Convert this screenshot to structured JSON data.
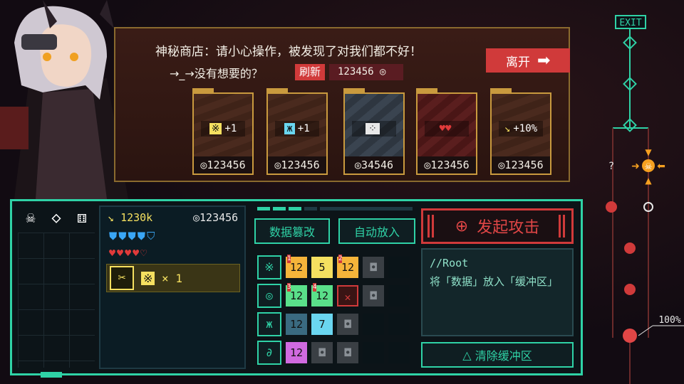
{
  "shop": {
    "title": "神秘商店：请小心操作，被发现了对我们都不好！",
    "subtitle": "→_→没有想要的？",
    "refresh_label": "刷新",
    "refresh_cost": "123456",
    "leave_label": "离开",
    "cards": [
      {
        "item": "+1",
        "icon": "gold-chip-icon",
        "price": "123456"
      },
      {
        "item": "+1",
        "icon": "blue-chip-icon",
        "price": "123456"
      },
      {
        "item": "",
        "icon": "dice-icon",
        "price": "34546"
      },
      {
        "item": "",
        "icon": "double-heart-icon",
        "price": "123456"
      },
      {
        "item": "+10%",
        "icon": "cursor-icon",
        "price": "123456"
      }
    ]
  },
  "stats": {
    "power": "1230k",
    "money": "123456",
    "shields_full": 4,
    "shields_total": 5,
    "hearts_full": 4,
    "hearts_total": 5,
    "hand_item": "× 1"
  },
  "actions": {
    "tamper_label": "数据篡改",
    "auto_label": "自动放入",
    "attack_label": "发起攻击",
    "clear_label": "清除缓冲区"
  },
  "grid": {
    "rows": [
      {
        "icon": "※",
        "cells": [
          {
            "value": "12",
            "color": "#f5b43a",
            "badge": "1"
          },
          {
            "value": "5",
            "color": "#f5e060",
            "badge": ""
          },
          {
            "value": "12",
            "color": "#f5b43a",
            "badge": "2"
          },
          {
            "value": "",
            "color": "lock",
            "badge": ""
          }
        ]
      },
      {
        "icon": "◎",
        "cells": [
          {
            "value": "12",
            "color": "#5ae08a",
            "badge": "3"
          },
          {
            "value": "12",
            "color": "#5ae08a",
            "badge": "4"
          },
          {
            "value": "",
            "color": "x",
            "badge": ""
          },
          {
            "value": "",
            "color": "lock",
            "badge": ""
          }
        ]
      },
      {
        "icon": "ж",
        "cells": [
          {
            "value": "12",
            "color": "#3a6a80",
            "badge": ""
          },
          {
            "value": "7",
            "color": "#6ad6f0",
            "badge": ""
          },
          {
            "value": "",
            "color": "lock",
            "badge": ""
          }
        ]
      },
      {
        "icon": "∂",
        "cells": [
          {
            "value": "12",
            "color": "#d06ae0",
            "badge": ""
          },
          {
            "value": "",
            "color": "lock",
            "badge": ""
          },
          {
            "value": "",
            "color": "lock",
            "badge": ""
          }
        ]
      }
    ]
  },
  "console": {
    "path": "//Root",
    "text": "将「数据」放入「缓冲区」"
  },
  "map": {
    "exit_label": "EXIT",
    "unknown_label": "?",
    "progress": "100%"
  },
  "colors": {
    "accent": "#2fd2a6",
    "danger": "#d03a3a",
    "gold": "#c99a3e"
  }
}
